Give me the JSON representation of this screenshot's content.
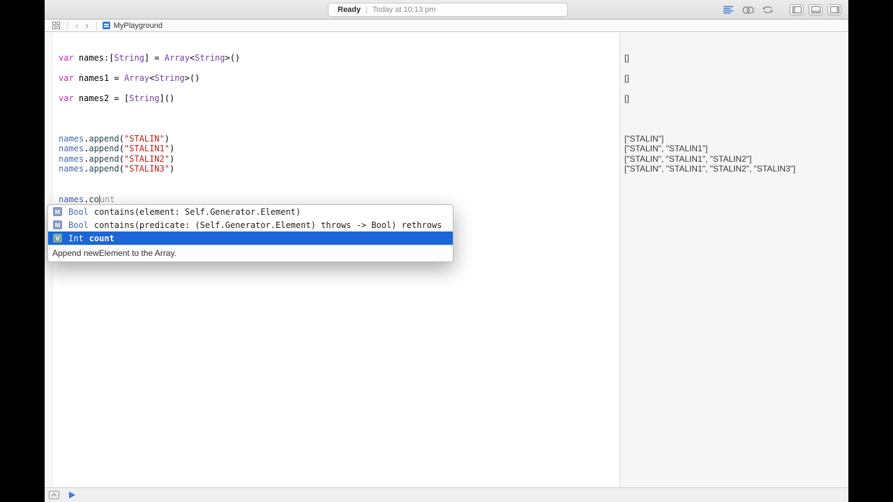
{
  "colors": {
    "keyword": "#BA2DA2",
    "type": "#703DAA",
    "variable": "#4667B2",
    "method": "#26474E",
    "string": "#C41A16",
    "ghost": "#9B9B9B",
    "selection": "#1B66D9",
    "icon_method": "#8496C4",
    "icon_variable": "#7BA8A3",
    "play": "#3A7CE0",
    "active_editor_icon": "#437FD7"
  },
  "toolbar": {
    "status": {
      "ready": "Ready",
      "divider": "|",
      "message": "Today at 10:13 pm"
    }
  },
  "jump_bar": {
    "back": "‹",
    "forward": "›",
    "file": "MyPlayground"
  },
  "editor": {
    "lines": [
      {
        "segments": [],
        "result": ""
      },
      {
        "segments": [
          {
            "t": "var ",
            "c": "keyword"
          },
          {
            "t": "names:[",
            "c": "plain"
          },
          {
            "t": "String",
            "c": "type"
          },
          {
            "t": "] = ",
            "c": "plain"
          },
          {
            "t": "Array",
            "c": "type"
          },
          {
            "t": "<",
            "c": "plain"
          },
          {
            "t": "String",
            "c": "type"
          },
          {
            "t": ">()",
            "c": "plain"
          }
        ],
        "result": "[]"
      },
      {
        "segments": [],
        "result": ""
      },
      {
        "segments": [
          {
            "t": "var ",
            "c": "keyword"
          },
          {
            "t": "names1 = ",
            "c": "plain"
          },
          {
            "t": "Array",
            "c": "type"
          },
          {
            "t": "<",
            "c": "plain"
          },
          {
            "t": "String",
            "c": "type"
          },
          {
            "t": ">()",
            "c": "plain"
          }
        ],
        "result": "[]"
      },
      {
        "segments": [],
        "result": ""
      },
      {
        "segments": [
          {
            "t": "var ",
            "c": "keyword"
          },
          {
            "t": "names2 = [",
            "c": "plain"
          },
          {
            "t": "String",
            "c": "type"
          },
          {
            "t": "]()",
            "c": "plain"
          }
        ],
        "result": "[]"
      },
      {
        "segments": [],
        "result": ""
      },
      {
        "segments": [],
        "result": ""
      },
      {
        "segments": [],
        "result": ""
      },
      {
        "segments": [
          {
            "t": "names",
            "c": "variable"
          },
          {
            "t": ".",
            "c": "plain"
          },
          {
            "t": "append",
            "c": "method"
          },
          {
            "t": "(",
            "c": "plain"
          },
          {
            "t": "\"STALIN\"",
            "c": "string"
          },
          {
            "t": ")",
            "c": "plain"
          }
        ],
        "result": "[\"STALIN\"]"
      },
      {
        "segments": [
          {
            "t": "names",
            "c": "variable"
          },
          {
            "t": ".",
            "c": "plain"
          },
          {
            "t": "append",
            "c": "method"
          },
          {
            "t": "(",
            "c": "plain"
          },
          {
            "t": "\"STALIN1\"",
            "c": "string"
          },
          {
            "t": ")",
            "c": "plain"
          }
        ],
        "result": "[\"STALIN\", \"STALIN1\"]"
      },
      {
        "segments": [
          {
            "t": "names",
            "c": "variable"
          },
          {
            "t": ".",
            "c": "plain"
          },
          {
            "t": "append",
            "c": "method"
          },
          {
            "t": "(",
            "c": "plain"
          },
          {
            "t": "\"STALIN2\"",
            "c": "string"
          },
          {
            "t": ")",
            "c": "plain"
          }
        ],
        "result": "[\"STALIN\", \"STALIN1\", \"STALIN2\"]"
      },
      {
        "segments": [
          {
            "t": "names",
            "c": "variable"
          },
          {
            "t": ".",
            "c": "plain"
          },
          {
            "t": "append",
            "c": "method"
          },
          {
            "t": "(",
            "c": "plain"
          },
          {
            "t": "\"STALIN3\"",
            "c": "string"
          },
          {
            "t": ")",
            "c": "plain"
          }
        ],
        "result": "[\"STALIN\", \"STALIN1\", \"STALIN2\", \"STALIN3\"]"
      },
      {
        "segments": [],
        "result": ""
      },
      {
        "segments": [],
        "result": ""
      },
      {
        "segments": [
          {
            "t": "names",
            "c": "variable"
          },
          {
            "t": ".",
            "c": "plain"
          },
          {
            "t": "co",
            "c": "method"
          },
          {
            "t": "",
            "c": "cursor"
          },
          {
            "t": "unt",
            "c": "ghost"
          }
        ],
        "result": ""
      }
    ]
  },
  "autocomplete": {
    "items": [
      {
        "badge": "M",
        "kind": "method",
        "return_type": "Bool",
        "label": "contains(element: Self.Generator.Element)",
        "selected": false
      },
      {
        "badge": "M",
        "kind": "method",
        "return_type": "Bool",
        "label": "contains(predicate: (Self.Generator.Element) throws -> Bool) rethrows",
        "selected": false
      },
      {
        "badge": "V",
        "kind": "variable",
        "return_type": "Int",
        "label": "count",
        "selected": true
      }
    ],
    "description": "Append newElement to the Array."
  }
}
